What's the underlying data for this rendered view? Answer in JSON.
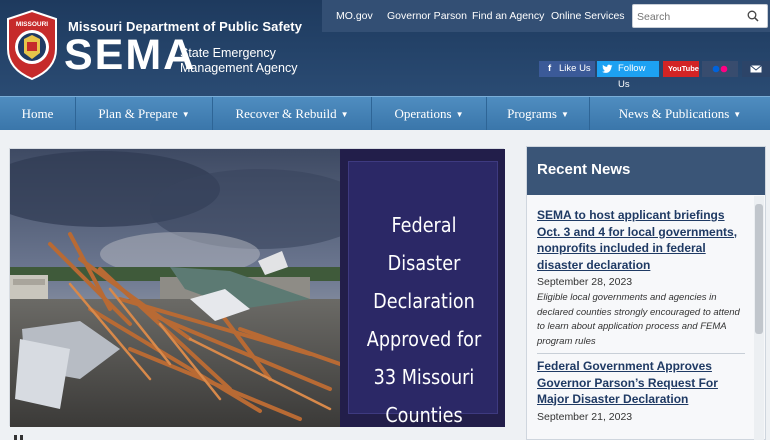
{
  "header": {
    "department": "Missouri Department of Public Safety",
    "logo_text": "SEMA",
    "agency_line1": "State Emergency",
    "agency_line2": "Management Agency",
    "seal_text": "MISSOURI"
  },
  "top_links": [
    "MO.gov",
    "Governor Parson",
    "Find an Agency",
    "Online Services"
  ],
  "search": {
    "placeholder": "Search"
  },
  "social": {
    "facebook_label": "Like Us",
    "twitter_label": "Follow Us",
    "youtube_label": "YouTube"
  },
  "nav": [
    {
      "label": "Home"
    },
    {
      "label": "Plan & Prepare"
    },
    {
      "label": "Recover & Rebuild"
    },
    {
      "label": "Operations"
    },
    {
      "label": "Programs"
    },
    {
      "label": "News & Publications"
    }
  ],
  "hero": {
    "line1": "Federal Disaster",
    "line2": "Declaration",
    "line3": "Approved for",
    "line4": "33 Missouri",
    "line5": "Counties"
  },
  "recent_news": {
    "title": "Recent News",
    "items": [
      {
        "title": "SEMA to host applicant briefings Oct. 3 and 4 for local governments, nonprofits included in federal disaster declaration",
        "date": "September 28, 2023",
        "description": "Eligible local governments and agencies in declared counties strongly encouraged to attend to learn about application process and FEMA program rules"
      },
      {
        "title": "Federal Government Approves Governor Parson’s Request For Major Disaster Declaration",
        "date": "September 21, 2023",
        "description": ""
      }
    ]
  },
  "colors": {
    "header_bg": "#1e3a5e",
    "nav_bg": "#3a76aa",
    "news_header_bg": "#3a5577",
    "link_color": "#1f3a64",
    "hero_panel_bg": "#221e4a"
  }
}
